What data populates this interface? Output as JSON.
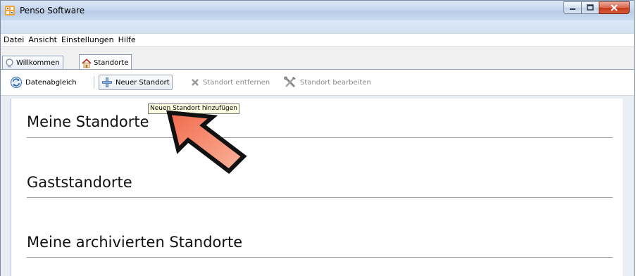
{
  "window": {
    "title": "Penso Software",
    "accent": "#4a6ea5"
  },
  "menu": {
    "items": [
      {
        "label": "Datei"
      },
      {
        "label": "Ansicht"
      },
      {
        "label": "Einstellungen"
      },
      {
        "label": "Hilfe"
      }
    ]
  },
  "tabs": [
    {
      "label": "Willkommen",
      "icon": "lightbulb-icon",
      "active": false
    },
    {
      "label": "Standorte",
      "icon": "house-icon",
      "active": true
    }
  ],
  "toolbar": {
    "sync_label": "Datenabgleich",
    "new_label": "Neuer Standort",
    "remove_label": "Standort entfernen",
    "edit_label": "Standort bearbeiten"
  },
  "tooltip": {
    "text": "Neuen Standort hinzufügen"
  },
  "sections": {
    "mine": "Meine Standorte",
    "guest": "Gaststandorte",
    "archived": "Meine archivierten Standorte"
  },
  "annotation": {
    "icon": "pointer-arrow-icon",
    "color": "#f47e5f"
  }
}
